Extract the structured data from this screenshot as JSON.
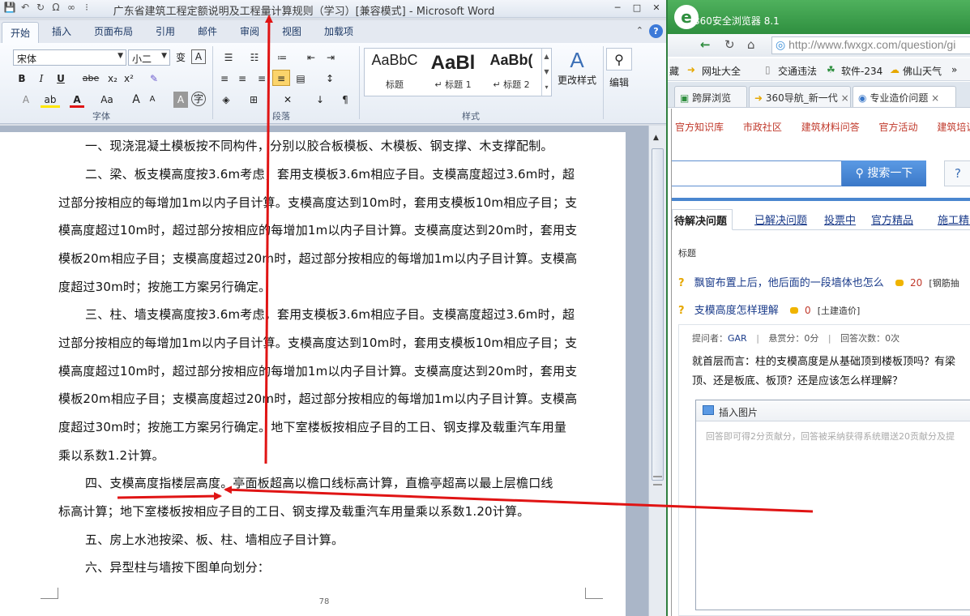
{
  "word": {
    "title": "广东省建筑工程定额说明及工程量计算规则（学习）[兼容模式] - Microsoft Word",
    "window_controls": [
      "─",
      "□",
      "✕"
    ],
    "tabs": [
      "开始",
      "插入",
      "页面布局",
      "引用",
      "邮件",
      "审阅",
      "视图",
      "加载项"
    ],
    "active_tab": "开始",
    "ribbon": {
      "font_name": "宋体",
      "font_size": "小二",
      "group_font": "字体",
      "group_paragraph": "段落",
      "group_styles": "样式",
      "styles": [
        {
          "sample": "AaBbC",
          "caption": "标题"
        },
        {
          "sample": "AaBl",
          "caption": "↵ 标题 1"
        },
        {
          "sample": "AaBb(",
          "caption": "↵ 标题 2"
        }
      ],
      "change_styles": "更改样式",
      "editing": "编辑",
      "bold": "B",
      "italic": "I",
      "underline": "U",
      "strike": "abe",
      "subscript": "x₂",
      "superscript": "x²",
      "grow_font": "A",
      "shrink_font": "A",
      "font_color": "A",
      "change_case": "Aa"
    },
    "paragraphs": [
      "一、现浇混凝土模板按不同构件，分别以胶合板模板、木模板、钢支撑、木支撑配制。",
      "二、梁、板支模高度按3.6m考虑，套用支模板3.6m相应子目。支模高度超过3.6m时，超",
      "过部分按相应的每增加1m以内子目计算。支模高度达到10m时，套用支模板10m相应子目；支",
      "模高度超过10m时，超过部分按相应的每增加1m以内子目计算。支模高度达到20m时，套用支",
      "模板20m相应子目；支模高度超过20m时，超过部分按相应的每增加1m以内子目计算。支模高",
      "度超过30m时；按施工方案另行确定。",
      "三、柱、墙支模高度按3.6m考虑，套用支模板3.6m相应子目。支模高度超过3.6m时，超",
      "过部分按相应的每增加1m以内子目计算。支模高度达到10m时，套用支模板10m相应子目；支",
      "模高度超过10m时，超过部分按相应的每增加1m以内子目计算。支模高度达到20m时，套用支",
      "模板20m相应子目；支模高度超过20m时，超过部分按相应的每增加1m以内子目计算。支模高",
      "度超过30m时；按施工方案另行确定。地下室楼板按相应子目的工日、钢支撑及载重汽车用量",
      "乘以系数1.2计算。",
      "四、支模高度指楼层高度。亭面板超高以檐口线标高计算，直檐亭超高以最上层檐口线",
      "标高计算；地下室楼板按相应子目的工日、钢支撑及载重汽车用量乘以系数1.20计算。",
      "五、房上水池按梁、板、柱、墙相应子目计算。",
      "六、异型柱与墙按下图单向划分："
    ],
    "page_number": "78"
  },
  "browser": {
    "title": "360安全浏览器 8.1",
    "address": "http://www.fwxgx.com/question/gi",
    "bookmarks": [
      "藏",
      "网址大全",
      "交通违法",
      "软件-234",
      "佛山天气",
      "»"
    ],
    "tabs": [
      "跨屏浏览",
      "360导航_新一代",
      "专业造价问题"
    ],
    "site_nav": [
      "官方知识库",
      "市政社区",
      "建筑材料问答",
      "官方活动",
      "建筑培训"
    ],
    "search_button": "搜索一下",
    "help_button": "?",
    "question_tabs": [
      "待解决问题",
      "已解决问题",
      "投票中",
      "官方精品",
      "施工精品"
    ],
    "list_header": "标题",
    "questions": [
      {
        "title": "飘窗布置上后，他后面的一段墙体也怎么",
        "points": "20",
        "category": "[钢筋抽"
      },
      {
        "title": "支模高度怎样理解",
        "points": "0",
        "category": "[土建造价]"
      }
    ],
    "detail": {
      "asker_label": "提问者：",
      "asker": "GAR",
      "reward": "悬赏分：0分",
      "answers": "回答次数：0次",
      "body_line1": "就首层而言：柱的支模高度是从基础顶到楼板顶吗？有梁",
      "body_line2": "顶、还是板底、板顶？还是应该怎么样理解？",
      "insert_image": "插入图片",
      "reply_placeholder": "回答即可得2分贡献分，回答被采纳获得系统赠送20贡献分及提"
    }
  },
  "colors": {
    "annotation": "#e01414",
    "browser_green": "#2f8f3f",
    "link_blue": "#1a3b8a",
    "site_red": "#c0392b"
  }
}
